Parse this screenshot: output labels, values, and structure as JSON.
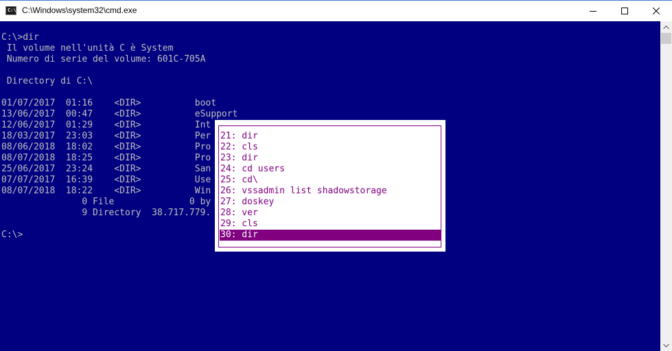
{
  "window": {
    "title": "C:\\Windows\\system32\\cmd.exe",
    "icon": "cmd-icon",
    "icon_label": "C:\\",
    "controls": [
      "minimize-icon",
      "maximize-icon",
      "close-icon"
    ]
  },
  "console": {
    "lines": [
      "C:\\>dir",
      " Il volume nell'unità C è System",
      " Numero di serie del volume: 601C-705A",
      "",
      " Directory di C:\\",
      "",
      "01/07/2017  01:16    <DIR>          boot",
      "13/06/2017  00:47    <DIR>          eSupport",
      "12/06/2017  01:29    <DIR>          Int",
      "18/03/2017  23:03    <DIR>          Per",
      "08/06/2018  18:02    <DIR>          Pro",
      "08/07/2018  18:25    <DIR>          Pro",
      "25/06/2017  23:24    <DIR>          San",
      "07/07/2017  16:39    <DIR>          Use",
      "08/07/2018  18:22    <DIR>          Win",
      "               0 File              0 by",
      "               9 Directory  38.717.779.",
      "",
      "C:\\>"
    ],
    "text_color": "#c0c0c0",
    "background": "#000080"
  },
  "history_popup": {
    "items": [
      "21: dir",
      "22: cls",
      "23: dir",
      "24: cd users",
      "25: cd\\",
      "26: vssadmin list shadowstorage",
      "27: doskey",
      "28: ver",
      "29: cls",
      "30: dir"
    ],
    "selected_index": 9,
    "text_color": "#800080",
    "background": "#ffffff"
  }
}
